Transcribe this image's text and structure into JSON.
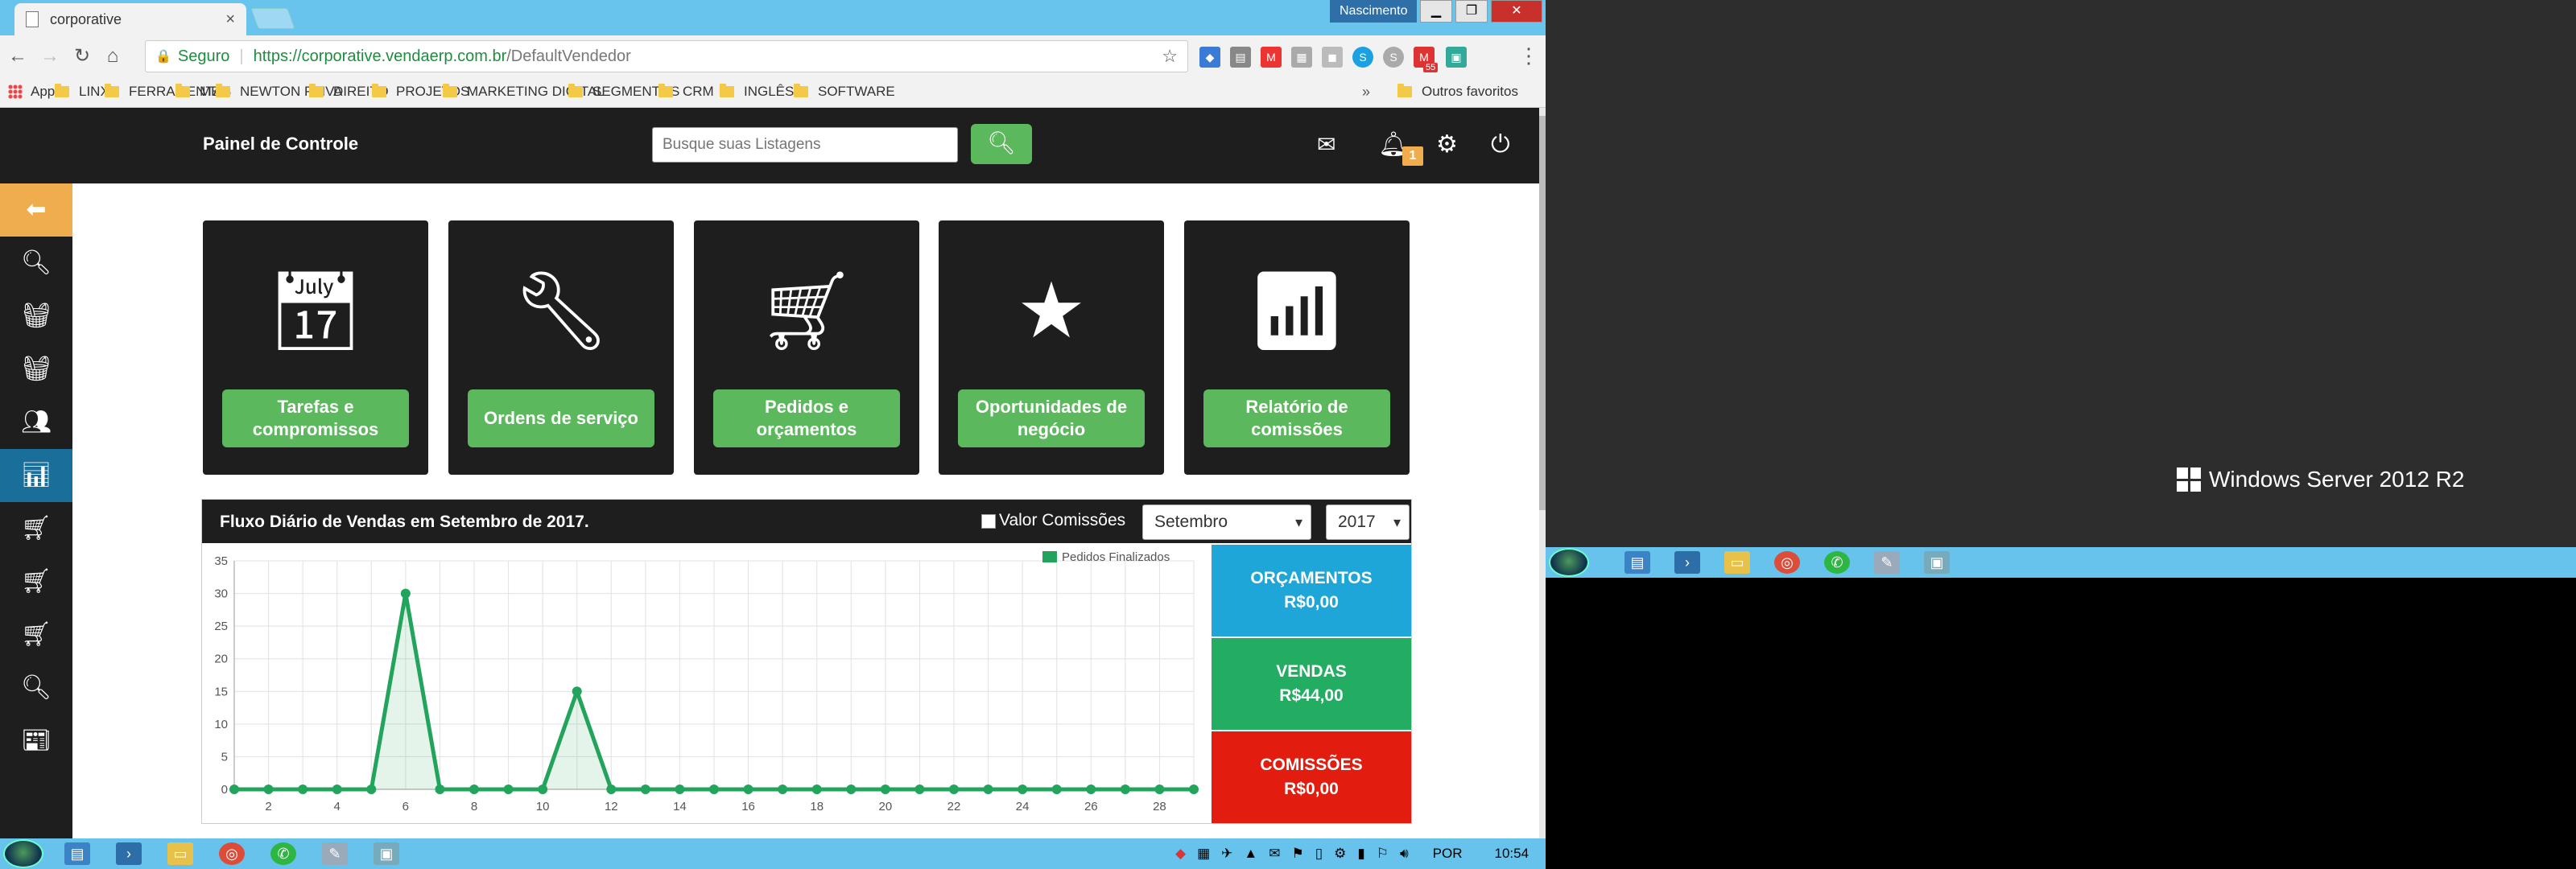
{
  "browser": {
    "tab_title": "corporative",
    "window_user": "Nascimento",
    "win_min": "▁",
    "win_max": "❐",
    "win_close": "✕",
    "secure_label": "Seguro",
    "url_host": "https://corporative.vendaerp.com.br",
    "url_path": "/DefaultVendedor",
    "gmail_badge": "55"
  },
  "bookmarks": {
    "apps": "Apps",
    "items": [
      "LINX",
      "FERRAMENTAS",
      "MEI",
      "NEWTON PAIVA",
      "DIREITO",
      "PROJETOS",
      "MARKETING DIGITAL",
      "SEGMENTOS",
      "CRM",
      "INGLÊS",
      "SOFTWARE"
    ],
    "more": "»",
    "other": "Outros favoritos"
  },
  "header": {
    "brand": "Painel de Controle",
    "search_placeholder": "Busque suas Listagens",
    "notif_count": "1"
  },
  "cards": [
    {
      "label": "Tarefas e compromissos",
      "icon": "calendar-icon"
    },
    {
      "label": "Ordens de serviço",
      "icon": "wrench-icon"
    },
    {
      "label": "Pedidos e orçamentos",
      "icon": "cart-icon"
    },
    {
      "label": "Oportunidades de negócio",
      "icon": "star-icon"
    },
    {
      "label": "Relatório de comissões",
      "icon": "bar-chart-icon"
    }
  ],
  "panel": {
    "title": "Fluxo Diário de Vendas em Setembro de 2017.",
    "checkbox_label": "Valor Comissões",
    "month": "Setembro",
    "year": "2017"
  },
  "stats": [
    {
      "title": "ORÇAMENTOS",
      "value": "R$0,00",
      "color": "#1ea6d8"
    },
    {
      "title": "VENDAS",
      "value": "R$44,00",
      "color": "#22ad62"
    },
    {
      "title": "COMISSÕES",
      "value": "R$0,00",
      "color": "#e21c0e"
    }
  ],
  "chart_data": {
    "type": "line",
    "categories": [
      "1",
      "2",
      "3",
      "4",
      "5",
      "6",
      "7",
      "8",
      "9",
      "10",
      "11",
      "12",
      "13",
      "14",
      "15",
      "16",
      "17",
      "18",
      "19",
      "20",
      "21",
      "22",
      "23",
      "24",
      "25",
      "26",
      "27",
      "28",
      "29"
    ],
    "x_tick_labels": [
      "2",
      "4",
      "6",
      "8",
      "10",
      "12",
      "14",
      "16",
      "18",
      "20",
      "22",
      "24",
      "26",
      "28"
    ],
    "series": [
      {
        "name": "Pedidos Finalizados",
        "color": "#22a45d",
        "values": [
          0,
          0,
          0,
          0,
          0,
          30,
          0,
          0,
          0,
          0,
          15,
          0,
          0,
          0,
          0,
          0,
          0,
          0,
          0,
          0,
          0,
          0,
          0,
          0,
          0,
          0,
          0,
          0,
          0
        ]
      }
    ],
    "ylim": [
      0,
      35
    ],
    "y_ticks": [
      "0",
      "5",
      "10",
      "15",
      "20",
      "25",
      "30",
      "35"
    ],
    "legend": "top-right",
    "grid": true
  },
  "taskbar": {
    "lang": "POR",
    "time": "10:54"
  },
  "desktop2": {
    "os_label": "Windows Server 2012 R2"
  }
}
